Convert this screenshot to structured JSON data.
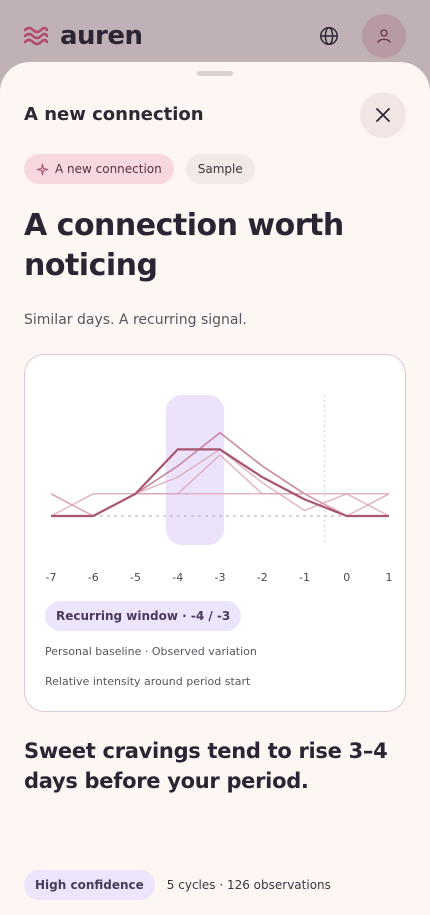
{
  "app": {
    "brand": "auren",
    "icons": {
      "logo": "waves-logo-icon",
      "language": "globe-icon",
      "profile": "user-icon",
      "close": "close-icon",
      "sparkle": "sparkle-icon"
    }
  },
  "sheet": {
    "title": "A new connection",
    "chips": [
      {
        "label": "A new connection"
      },
      {
        "label": "Sample"
      }
    ],
    "headline": "A connection worth noticing",
    "subtitle": "Similar days. A recurring signal.",
    "card": {
      "window_label": "Recurring window · -4 / -3",
      "legend_line": "Personal baseline · Observed variation",
      "caption": "Relative intensity around period start"
    },
    "statement": "Sweet cravings tend to rise 3–4 days before your period.",
    "confidence": "High confidence",
    "stats": "5 cycles · 126 observations"
  },
  "colors": {
    "accent_pink": "#f6d8de",
    "accent_lavender": "#ede5fb",
    "series_dark": "#a85572",
    "series_light": "#d9a4b7",
    "highlight": "#ece3fb"
  },
  "chart_data": {
    "type": "line",
    "x": [
      -7,
      -6,
      -5,
      -4,
      -3,
      -2,
      -1,
      0,
      1
    ],
    "tick_labels": [
      "-7",
      "-6",
      "-5",
      "-4",
      "-3",
      "-2",
      "-1",
      "0",
      "1"
    ],
    "highlight_range": [
      -4,
      -3
    ],
    "ylim": [
      0,
      1
    ],
    "series": [
      {
        "values": [
          0,
          0,
          0.2,
          0.6,
          0.6,
          0.35,
          0.15,
          0,
          0
        ],
        "style": "dark"
      },
      {
        "values": [
          0,
          0,
          0.2,
          0.45,
          0.75,
          0.45,
          0.2,
          0,
          0
        ],
        "style": "mid"
      },
      {
        "values": [
          0.2,
          0,
          0.2,
          0.2,
          0.2,
          0.2,
          0.2,
          0.2,
          0.2
        ],
        "style": "light"
      },
      {
        "values": [
          0,
          0.2,
          0.2,
          0.2,
          0.55,
          0.2,
          0.2,
          0,
          0.2
        ],
        "style": "light"
      },
      {
        "values": [
          0.2,
          0,
          0.2,
          0.35,
          0.6,
          0.3,
          0.05,
          0.2,
          0
        ],
        "style": "light"
      }
    ],
    "baseline": 0,
    "period_start_marker": 0
  }
}
